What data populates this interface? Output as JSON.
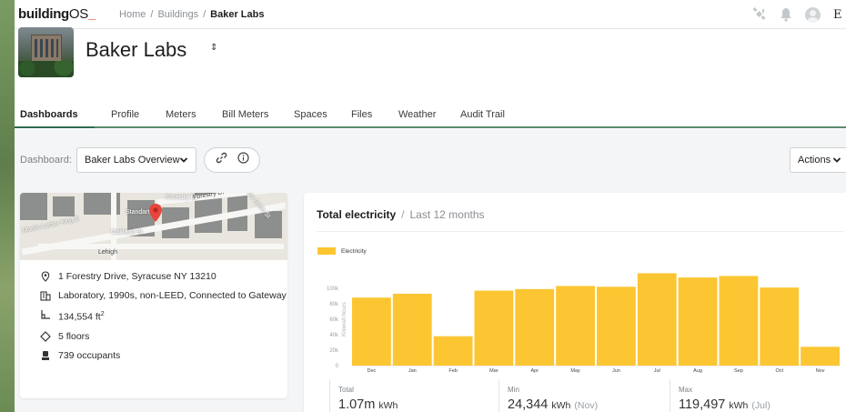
{
  "app": {
    "logo_bold": "building",
    "logo_light": "OS",
    "logo_mark": "_"
  },
  "breadcrumb": {
    "home": "Home",
    "sep1": "/",
    "buildings": "Buildings",
    "sep2": "/",
    "current": "Baker Labs"
  },
  "topbar": {
    "icons": [
      "satellite-icon",
      "bell-icon",
      "user-avatar-icon"
    ],
    "cut_letter": "E"
  },
  "building": {
    "name": "Baker Labs",
    "switcher_glyph": "⇕"
  },
  "tabs": [
    "Dashboards",
    "Profile",
    "Meters",
    "Bill Meters",
    "Spaces",
    "Files",
    "Weather",
    "Audit Trail"
  ],
  "active_tab": "Dashboards",
  "dashboard": {
    "label": "Dashboard:",
    "selected": "Baker Labs Overview",
    "actions_label": "Actions"
  },
  "map": {
    "streets": [
      "Forestry Dr",
      "Standart St",
      "Martin Luther King E",
      "Oakland St",
      "Lehigh",
      "Forestry Dr",
      "Mc Bride St"
    ]
  },
  "info": {
    "address": "1 Forestry Drive, Syracuse NY 13210",
    "building_type": "Laboratory, 1990s, non-LEED, Connected to Gateway",
    "area_value": "134,554 ft",
    "area_sup": "2",
    "floors": "5 floors",
    "occupants": "739 occupants"
  },
  "chart_header": {
    "title": "Total electricity",
    "separator": "/",
    "period": "Last 12 months"
  },
  "chart_data": {
    "type": "bar",
    "title": "Total electricity",
    "ylabel": "Kilowatt hours",
    "categories": [
      "Dec",
      "Jan",
      "Feb",
      "Mar",
      "Apr",
      "May",
      "Jun",
      "Jul",
      "Aug",
      "Sep",
      "Oct",
      "Nov"
    ],
    "series": [
      {
        "name": "Electricity",
        "values": [
          88000,
          93000,
          38000,
          97000,
          99000,
          103000,
          102000,
          119497,
          114000,
          116000,
          101000,
          24344
        ]
      }
    ],
    "y_ticks": [
      "100k",
      "80k",
      "60k",
      "40k",
      "20k",
      "0"
    ],
    "ylim": [
      0,
      120000
    ],
    "color": "#fcc633",
    "grid": false,
    "legend": "top-left"
  },
  "stats": {
    "total": {
      "label": "Total",
      "value": "1.07m",
      "unit": "kWh"
    },
    "min": {
      "label": "Min",
      "value": "24,344",
      "unit": "kWh",
      "month": "(Nov)"
    },
    "max": {
      "label": "Max",
      "value": "119,497",
      "unit": "kWh",
      "month": "(Jul)"
    }
  }
}
